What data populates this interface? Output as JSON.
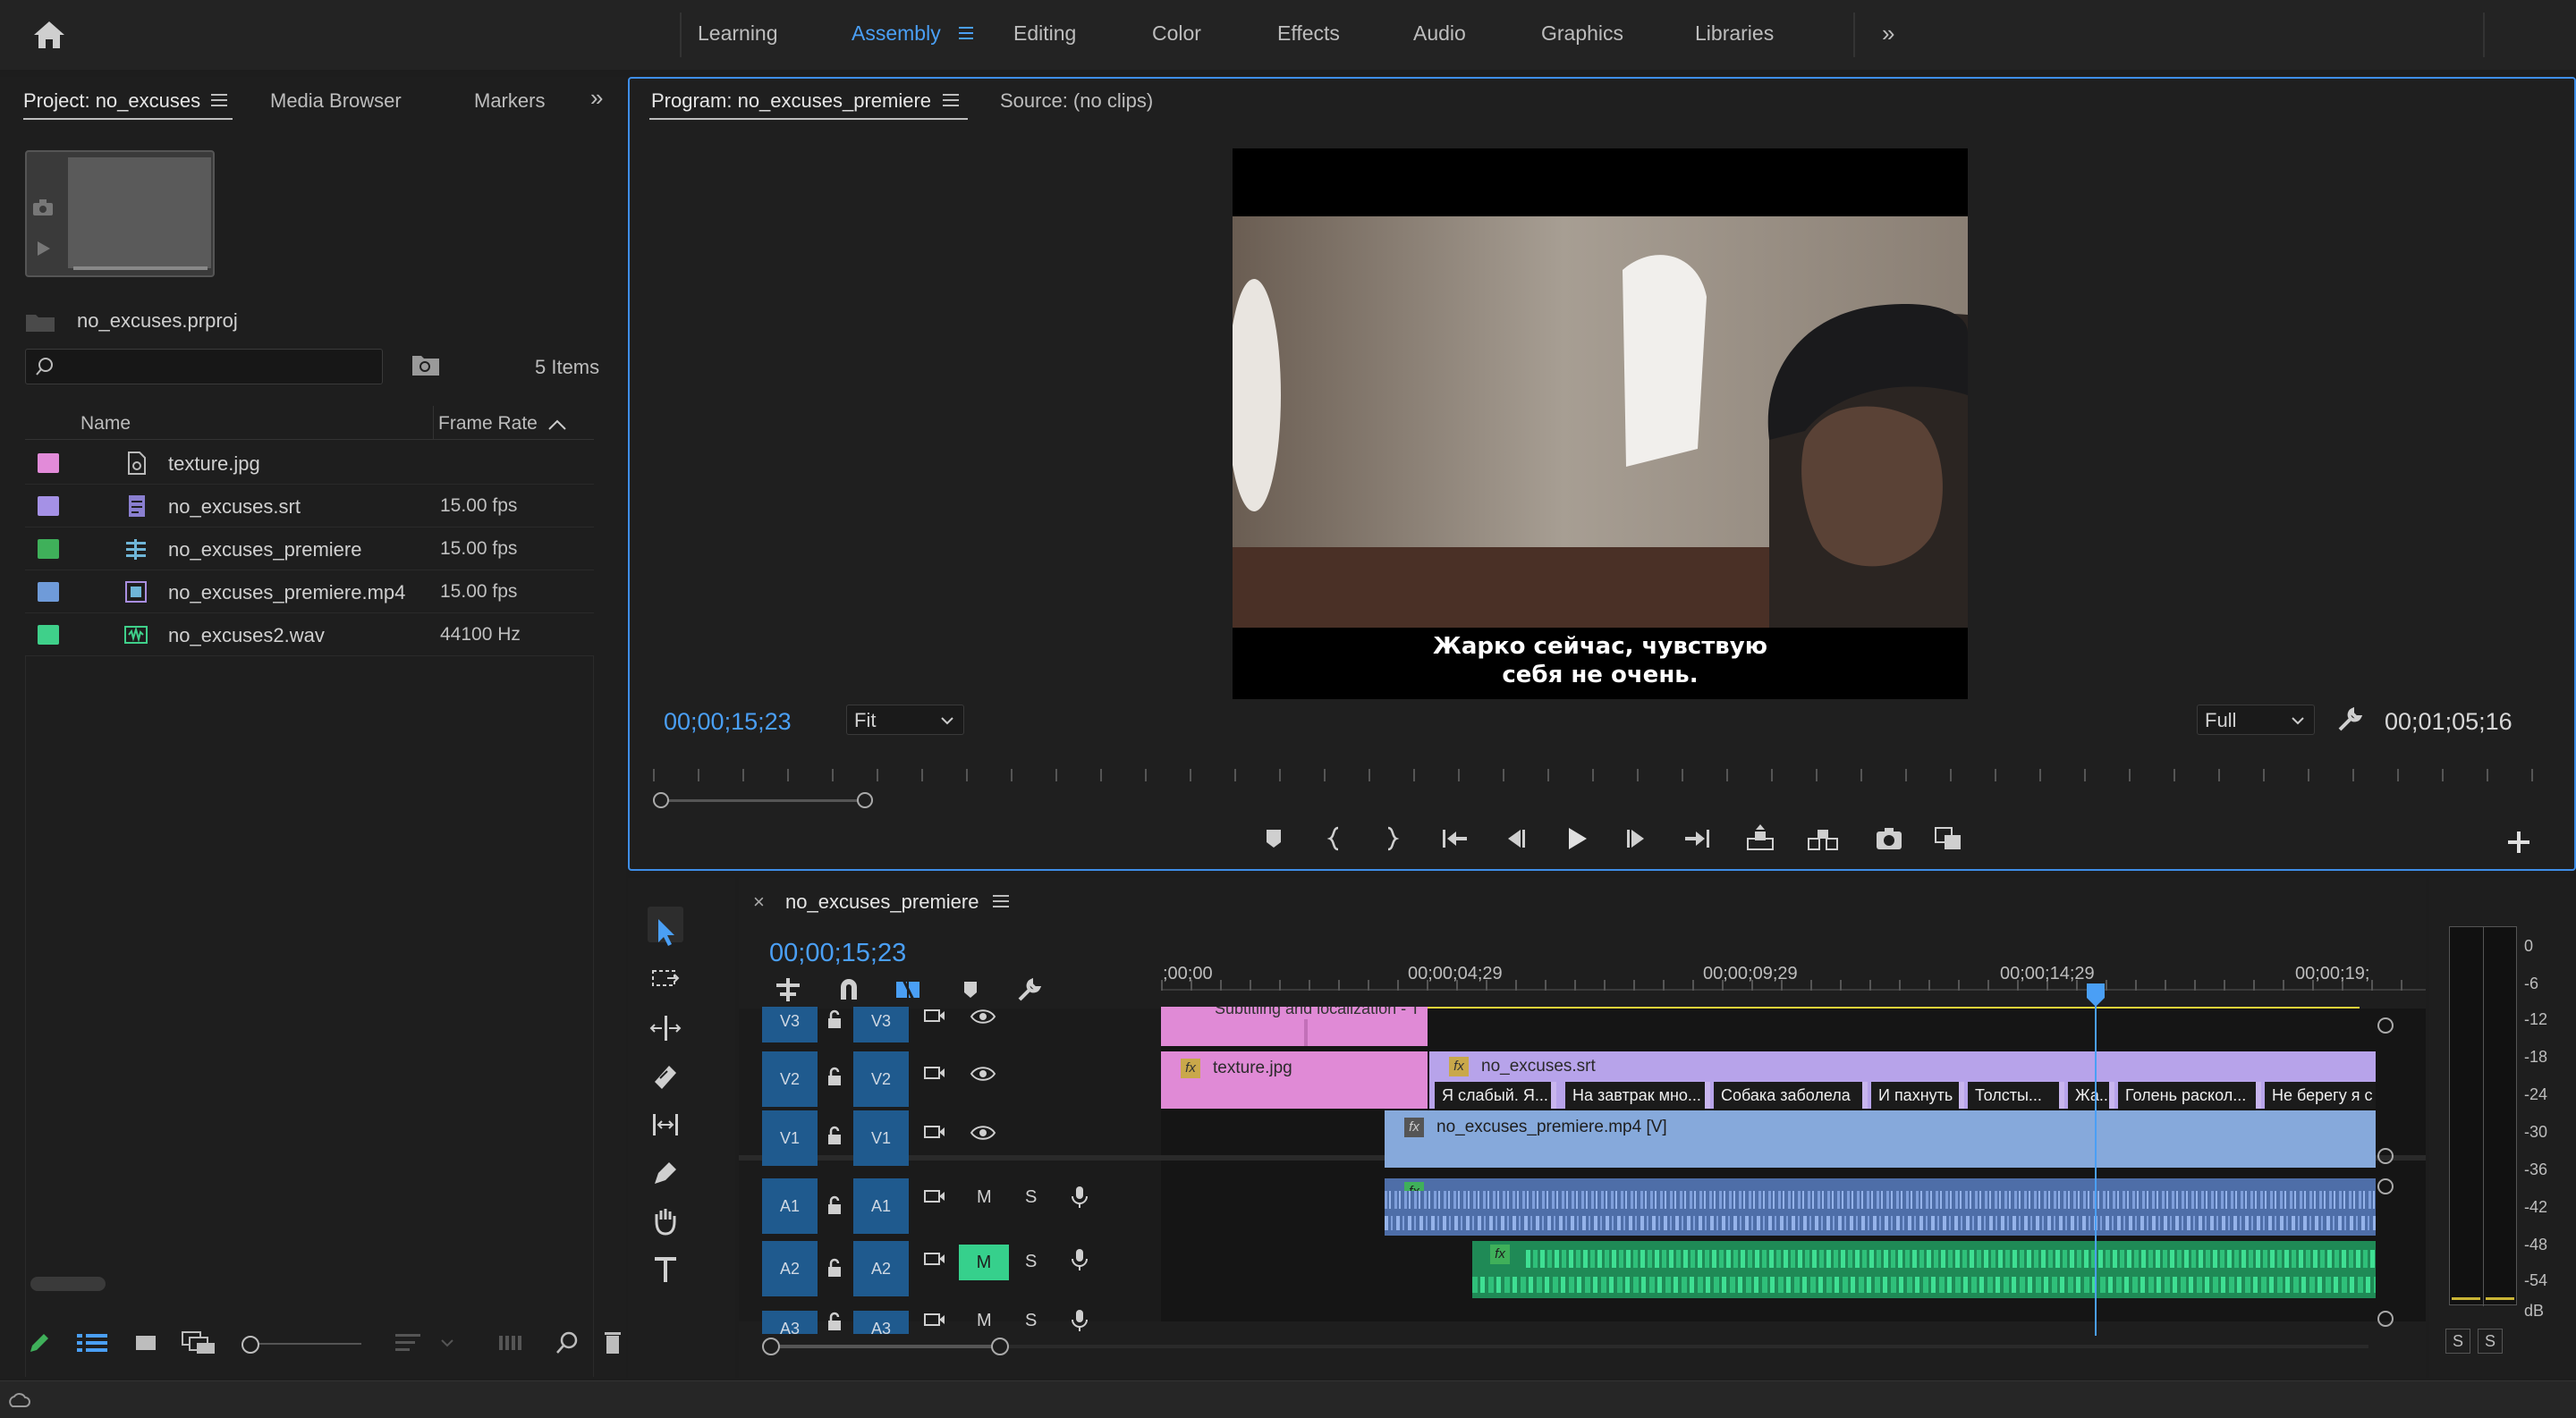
{
  "workspace_tabs": [
    {
      "label": "Learning"
    },
    {
      "label": "Assembly"
    },
    {
      "label": "Editing"
    },
    {
      "label": "Color"
    },
    {
      "label": "Effects"
    },
    {
      "label": "Audio"
    },
    {
      "label": "Graphics"
    },
    {
      "label": "Libraries"
    }
  ],
  "active_workspace": "Assembly",
  "project_panel": {
    "tabs": [
      {
        "label": "Project: no_excuses"
      },
      {
        "label": "Media Browser"
      },
      {
        "label": "Markers"
      }
    ],
    "project_file": "no_excuses.prproj",
    "item_count": "5 Items",
    "search_placeholder": "",
    "columns": {
      "name": "Name",
      "frame_rate": "Frame Rate"
    },
    "items": [
      {
        "name": "texture.jpg",
        "frame_rate": "",
        "color": "#e28bd9",
        "icon": "image-icon"
      },
      {
        "name": "no_excuses.srt",
        "frame_rate": "15.00 fps",
        "color": "#a591e6",
        "icon": "caption-icon"
      },
      {
        "name": "no_excuses_premiere",
        "frame_rate": "15.00 fps",
        "color": "#3fb05a",
        "icon": "sequence-icon"
      },
      {
        "name": "no_excuses_premiere.mp4",
        "frame_rate": "15.00 fps",
        "color": "#6f9bd9",
        "icon": "video-icon"
      },
      {
        "name": "no_excuses2.wav",
        "frame_rate": "44100 Hz",
        "color": "#3fd08a",
        "icon": "audio-icon"
      }
    ]
  },
  "program_panel": {
    "tabs": [
      {
        "label": "Program: no_excuses_premiere"
      },
      {
        "label": "Source: (no clips)"
      }
    ],
    "current_timecode": "00;00;15;23",
    "zoom": "Fit",
    "resolution": "Full",
    "duration": "00;01;05;16",
    "subtitle_lines": [
      "Жарко сейчас, чувствую",
      "себя не очень."
    ]
  },
  "timeline": {
    "sequence_tab": "no_excuses_premiere",
    "close_glyph": "×",
    "timecode": "00;00;15;23",
    "ruler_labels": [
      ";00;00",
      "00;00;04;29",
      "00;00;09;29",
      "00;00;14;29",
      "00;00;19;"
    ],
    "tracks": {
      "video": [
        "V3",
        "V2",
        "V1"
      ],
      "audio": [
        "A1",
        "A2",
        "A3"
      ]
    },
    "track_buttons": {
      "mute": "M",
      "solo": "S"
    },
    "clips": {
      "v3_clip": "Subtitling and localization - T",
      "texture": "texture.jpg",
      "srt": "no_excuses.srt",
      "video": "no_excuses_premiere.mp4 [V]",
      "fx": "fx"
    },
    "subtitle_segments": [
      "Я слабый. Я...",
      "На завтрак мно...",
      "Собака заболела",
      "И пахнуть",
      "Толсты...",
      "Жа...",
      "Голень раскол...",
      "Не берегу я с"
    ]
  },
  "audio_meter": {
    "scale": [
      "0",
      "-6",
      "-12",
      "-18",
      "-24",
      "-30",
      "-36",
      "-42",
      "-48",
      "-54",
      "dB"
    ],
    "solo_labels": [
      "S",
      "S"
    ]
  },
  "colors": {
    "accent": "#4a9ff5",
    "texture_clip": "#e08ad6",
    "srt_clip": "#b7a3ea",
    "video_clip": "#86a9db",
    "audio_a1": "#6d8fcf",
    "audio_a2": "#2fb575",
    "playhead": "#4a9ff5"
  }
}
